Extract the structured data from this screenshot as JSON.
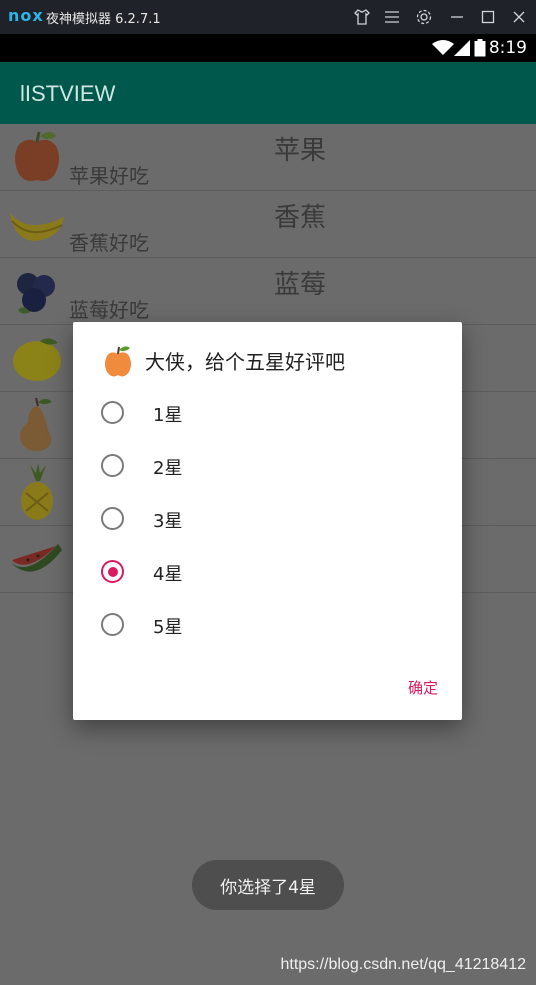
{
  "emulator": {
    "logo": "nox",
    "title": "夜神模拟器 6.2.7.1"
  },
  "status_bar": {
    "time": "8:19"
  },
  "app_bar": {
    "title": "lISTVIEW"
  },
  "list": {
    "items": [
      {
        "title": "苹果",
        "desc": "苹果好吃",
        "icon": "apple-icon"
      },
      {
        "title": "香蕉",
        "desc": "香蕉好吃",
        "icon": "banana-icon"
      },
      {
        "title": "蓝莓",
        "desc": "蓝莓好吃",
        "icon": "blueberry-icon"
      },
      {
        "title": "",
        "desc": "",
        "icon": "lemon-icon"
      },
      {
        "title": "",
        "desc": "",
        "icon": "pear-icon"
      },
      {
        "title": "",
        "desc": "",
        "icon": "pineapple-icon"
      },
      {
        "title": "",
        "desc": "",
        "icon": "watermelon-icon"
      }
    ]
  },
  "dialog": {
    "title": "大侠，给个五星好评吧",
    "icon": "apple-icon",
    "options": [
      {
        "label": "1星",
        "checked": false
      },
      {
        "label": "2星",
        "checked": false
      },
      {
        "label": "3星",
        "checked": false
      },
      {
        "label": "4星",
        "checked": true
      },
      {
        "label": "5星",
        "checked": false
      }
    ],
    "confirm_label": "确定",
    "accent_color": "#d81b60"
  },
  "toast": {
    "text": "你选择了4星"
  },
  "watermark": "https://blog.csdn.net/qq_41218412",
  "colors": {
    "app_bar": "#00574b",
    "accent": "#d81b60"
  }
}
